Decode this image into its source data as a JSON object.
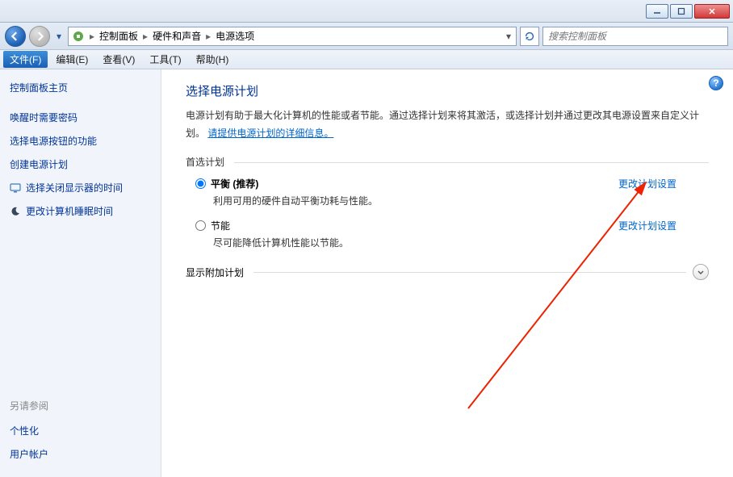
{
  "breadcrumb": {
    "root_icon": "control-panel-icon",
    "seg1": "控制面板",
    "seg2": "硬件和声音",
    "seg3": "电源选项"
  },
  "search": {
    "placeholder": "搜索控制面板"
  },
  "menu": {
    "file": "文件(F)",
    "edit": "编辑(E)",
    "view": "查看(V)",
    "tools": "工具(T)",
    "help": "帮助(H)"
  },
  "sidebar": {
    "home": "控制面板主页",
    "links": [
      {
        "label": "唤醒时需要密码"
      },
      {
        "label": "选择电源按钮的功能"
      },
      {
        "label": "创建电源计划"
      },
      {
        "label": "选择关闭显示器的时间",
        "icon": "monitor-icon"
      },
      {
        "label": "更改计算机睡眠时间",
        "icon": "moon-icon"
      }
    ],
    "see_also": "另请参阅",
    "extras": [
      {
        "label": "个性化"
      },
      {
        "label": "用户帐户"
      }
    ]
  },
  "main": {
    "title": "选择电源计划",
    "desc_pre": "电源计划有助于最大化计算机的性能或者节能。通过选择计划来将其激活，或选择计划并通过更改其电源设置来自定义计划。",
    "desc_link": "请提供电源计划的详细信息。",
    "preferred_label": "首选计划",
    "plans": [
      {
        "name": "平衡 (推荐)",
        "sub": "利用可用的硬件自动平衡功耗与性能。",
        "action": "更改计划设置",
        "selected": true
      },
      {
        "name": "节能",
        "sub": "尽可能降低计算机性能以节能。",
        "action": "更改计划设置",
        "selected": false
      }
    ],
    "expander_label": "显示附加计划"
  }
}
